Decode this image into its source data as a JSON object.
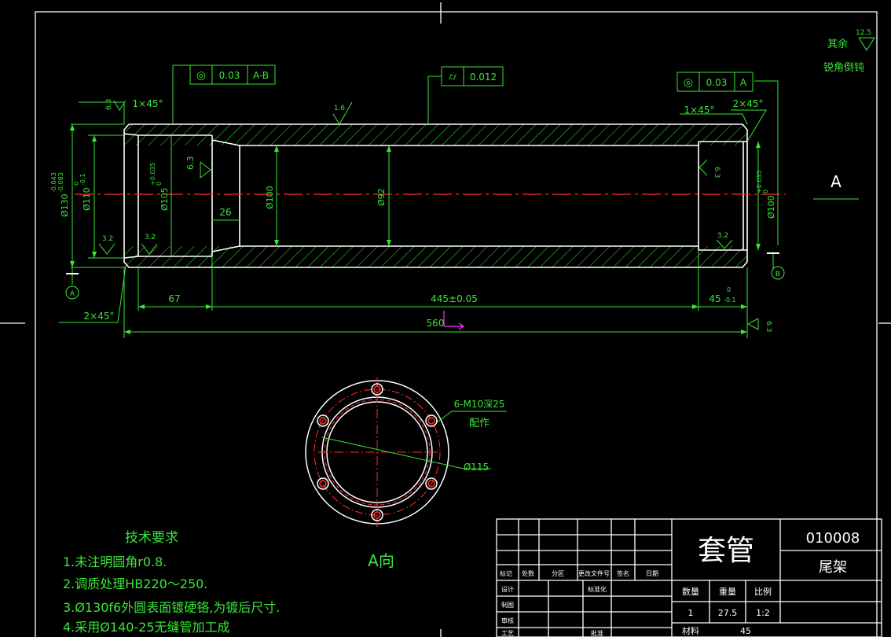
{
  "drawing": {
    "title": "套管",
    "drawing_number": "010008",
    "assembly": "尾架",
    "quantity": "1",
    "weight": "27.5",
    "scale": "1:2",
    "material": "45",
    "view_a_title": "A向",
    "section_marker": "A"
  },
  "notes": {
    "heading": "技术要求",
    "items": [
      "1.未注明圆角r0.8.",
      "2.调质处理HB220～250.",
      "3.Ø130f6外圆表面镀硬铬,为镀后尺寸.",
      "4.采用Ø140-25无缝管加工成"
    ]
  },
  "roughness_note": {
    "label1": "其余",
    "label2": "锐角倒钝",
    "value": "12.5"
  },
  "tolerance_frames": [
    {
      "symbol": "◎",
      "value": "0.03",
      "datum": "A-B"
    },
    {
      "symbol": "⌭",
      "value": "0.012",
      "datum": ""
    },
    {
      "symbol": "◎",
      "value": "0.03",
      "datum": "A"
    }
  ],
  "dimensions": {
    "len_67": "67",
    "len_445": "445±0.05",
    "len_45": "45",
    "len_45_tol": "0",
    "len_45_tol2": "-0.1",
    "len_560": "560",
    "len_26": "26",
    "d130": "Ø130",
    "d130_tol_up": "-0.043",
    "d130_tol_low": "-0.083",
    "d110": "Ø110",
    "d110_tol_up": "0",
    "d110_tol_low": "-0.1",
    "d105": "Ø105",
    "d105_tol_up": "+0.035",
    "d105_tol_low": "0",
    "d100": "Ø100",
    "d92": "Ø92",
    "d100r": "Ø100",
    "d100r_tol_up": "+0.035",
    "d100r_tol_low": "0",
    "chamfer_1": "1×45°",
    "chamfer_2": "1×45°",
    "chamfer_3": "2×45°",
    "chamfer_4": "2×45°",
    "holes": "6-M10深25",
    "holes_note": "配作",
    "d115": "Ø115"
  },
  "roughness": {
    "r1": "6.3",
    "r2": "1.6",
    "r3": "6.3",
    "r4": "3.2",
    "r5": "3.2",
    "r6": "6.3",
    "r7": "3.2",
    "r8": "6.3"
  },
  "datums": {
    "a": "A",
    "b": "B"
  },
  "title_block": {
    "headers": [
      "标记",
      "处数",
      "分区",
      "更改文件号",
      "签名",
      "日期"
    ],
    "rows": [
      "设计",
      "制图",
      "审核",
      "工艺"
    ],
    "standardization": "标准化",
    "approve": "批准",
    "col_qty": "数量",
    "col_weight": "重量",
    "col_scale": "比例",
    "col_material": "材料"
  },
  "colors": {
    "geometry": "#ffffff",
    "dimension": "#39e639",
    "centerline": "#ff2a2a",
    "axis": "#ff33ff"
  }
}
